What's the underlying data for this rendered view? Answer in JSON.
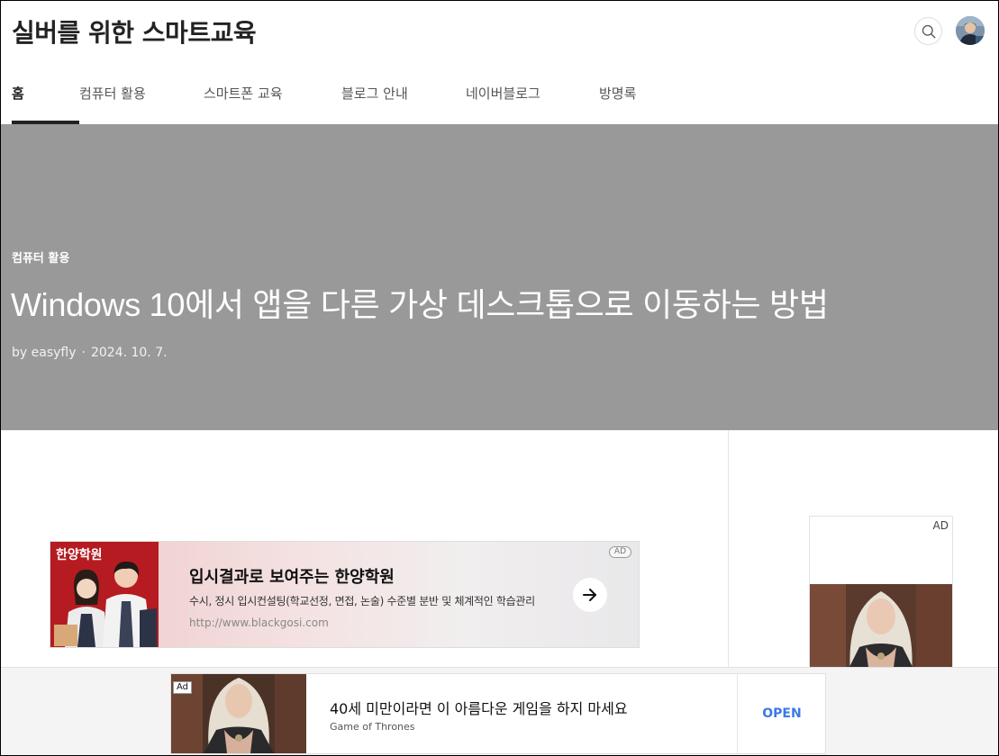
{
  "site": {
    "title": "실버를 위한 스마트교육"
  },
  "nav": {
    "items": [
      {
        "label": "홈",
        "active": true
      },
      {
        "label": "컴퓨터 활용"
      },
      {
        "label": "스마트폰 교육"
      },
      {
        "label": "블로그 안내"
      },
      {
        "label": "네이버블로그"
      },
      {
        "label": "방명록"
      }
    ]
  },
  "icons": {
    "search": "search-icon",
    "avatar": "profile-avatar",
    "arrow": "arrow-right-icon"
  },
  "hero": {
    "category": "컴퓨터 활용",
    "title": "Windows 10에서 앱을 다른 가상 데스크톱으로 이동하는 방법",
    "author": "by easyfly",
    "separator": "·",
    "date": "2024. 10. 7.",
    "background": "#999999"
  },
  "ad_banner": {
    "image_label": "한양학원",
    "badge": "AD",
    "headline": "입시결과로 보여주는 한양학원",
    "description": "수시, 정시 입시컨설팅(학교선정, 면접, 논술) 수준별 분반 및 체계적인 학습관리",
    "url": "http://www.blackgosi.com"
  },
  "side_ad": {
    "badge": "AD"
  },
  "sticky_ad": {
    "tag": "Ad",
    "title": "40세 미만이라면 이 아름다운 게임을 하지 마세요",
    "subtitle": "Game of Thrones",
    "cta": "OPEN",
    "cta_color": "#3b78e7"
  }
}
